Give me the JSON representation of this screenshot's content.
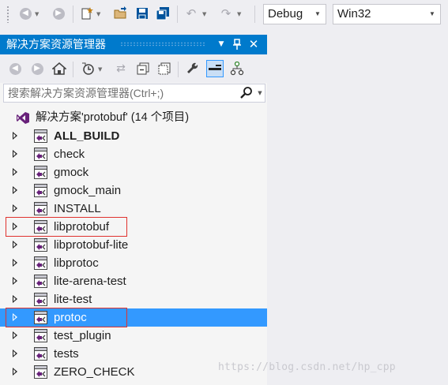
{
  "toolbar": {
    "icons": [
      "back-icon",
      "forward-icon",
      "new-project-icon",
      "open-icon",
      "save-icon",
      "save-all-icon",
      "undo-icon",
      "redo-icon"
    ],
    "configuration": "Debug",
    "platform": "Win32"
  },
  "panel": {
    "title": "解决方案资源管理器",
    "search_placeholder": "搜索解决方案资源管理器(Ctrl+;)"
  },
  "solution": {
    "label": "解决方案'protobuf' (14 个项目)"
  },
  "projects": [
    {
      "name": "ALL_BUILD",
      "bold": true
    },
    {
      "name": "check"
    },
    {
      "name": "gmock"
    },
    {
      "name": "gmock_main"
    },
    {
      "name": "INSTALL"
    },
    {
      "name": "libprotobuf",
      "boxed": true
    },
    {
      "name": "libprotobuf-lite"
    },
    {
      "name": "libprotoc"
    },
    {
      "name": "lite-arena-test"
    },
    {
      "name": "lite-test"
    },
    {
      "name": "protoc",
      "selected": true,
      "boxed": true
    },
    {
      "name": "test_plugin"
    },
    {
      "name": "tests"
    },
    {
      "name": "ZERO_CHECK"
    }
  ],
  "watermark": "https://blog.csdn.net/hp_cpp",
  "colors": {
    "accent": "#007acc",
    "selection": "#3399ff",
    "highlight_box": "#e0322e"
  }
}
